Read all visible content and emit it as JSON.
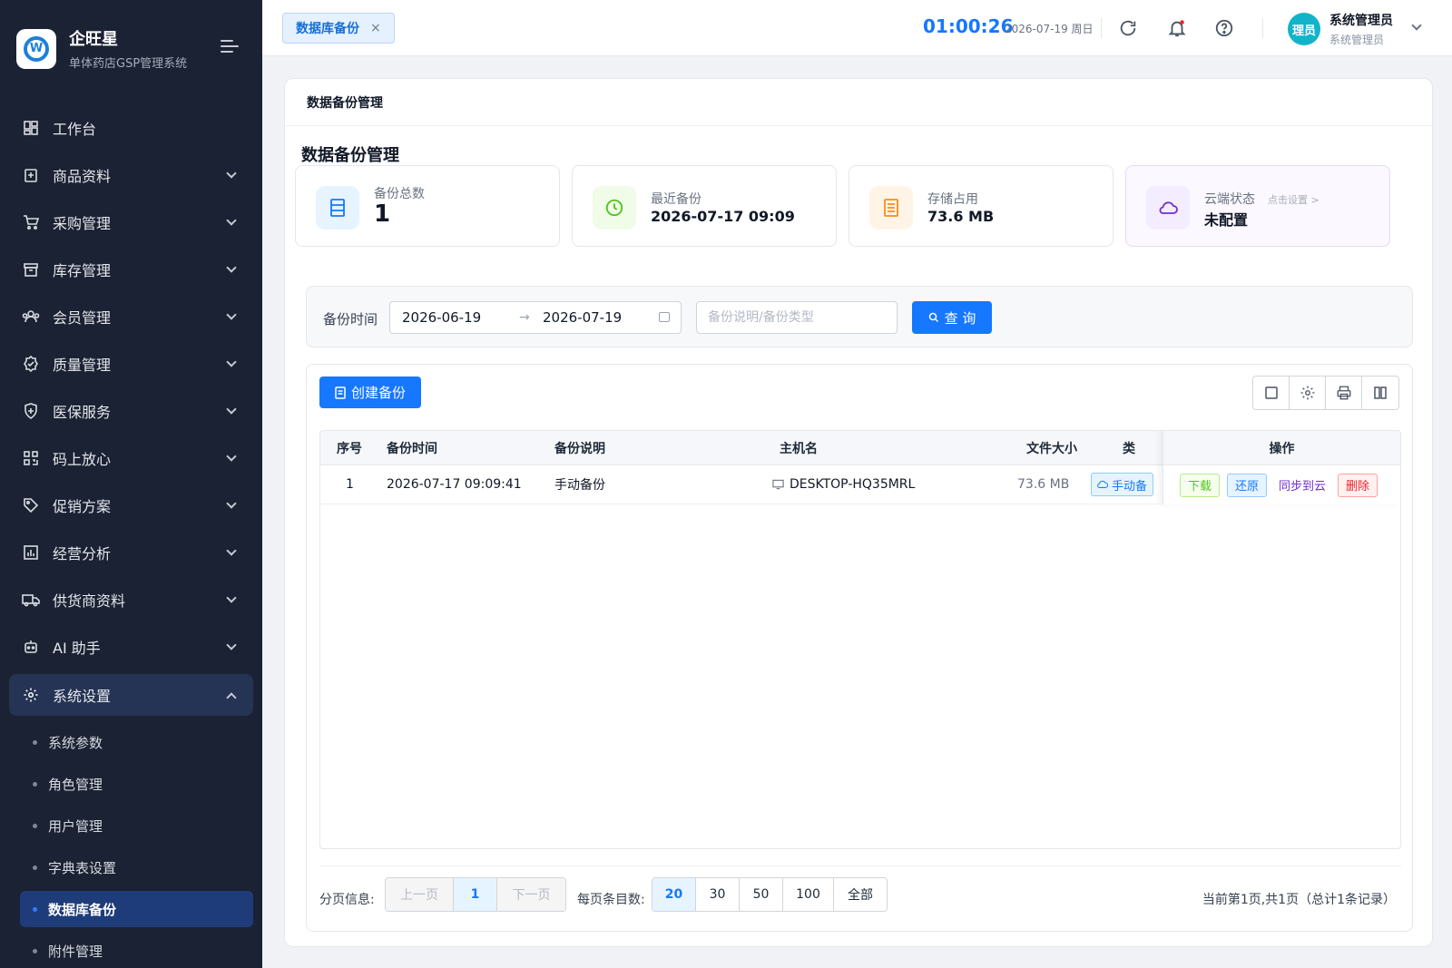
{
  "brand": {
    "title": "企旺星",
    "subtitle": "单体药店GSP管理系统"
  },
  "menu": [
    {
      "label": "工作台",
      "icon": "dashboard-icon",
      "expandable": false
    },
    {
      "label": "商品资料",
      "icon": "product-icon",
      "expandable": true
    },
    {
      "label": "采购管理",
      "icon": "cart-icon",
      "expandable": true
    },
    {
      "label": "库存管理",
      "icon": "inventory-icon",
      "expandable": true
    },
    {
      "label": "会员管理",
      "icon": "members-icon",
      "expandable": true
    },
    {
      "label": "质量管理",
      "icon": "quality-icon",
      "expandable": true
    },
    {
      "label": "医保服务",
      "icon": "shield-icon",
      "expandable": true
    },
    {
      "label": "码上放心",
      "icon": "qrcode-icon",
      "expandable": true
    },
    {
      "label": "促销方案",
      "icon": "tag-icon",
      "expandable": true
    },
    {
      "label": "经营分析",
      "icon": "analytics-icon",
      "expandable": true
    },
    {
      "label": "供货商资料",
      "icon": "truck-icon",
      "expandable": true
    },
    {
      "label": "AI 助手",
      "icon": "robot-icon",
      "expandable": true
    },
    {
      "label": "系统设置",
      "icon": "gear-icon",
      "expandable": true,
      "open": true
    }
  ],
  "submenu": [
    {
      "label": "系统参数"
    },
    {
      "label": "角色管理"
    },
    {
      "label": "用户管理"
    },
    {
      "label": "字典表设置"
    },
    {
      "label": "数据库备份",
      "active": true
    },
    {
      "label": "附件管理"
    }
  ],
  "header": {
    "tab_label": "数据库备份",
    "tab_close": "×",
    "clock": "01:00:26",
    "date": "2026-07-19 周日",
    "user_avatar": "理员",
    "user_name": "系统管理员",
    "user_role": "系统管理员"
  },
  "panel": {
    "breadcrumb": "数据备份管理",
    "title": "数据备份管理"
  },
  "stats": [
    {
      "label": "备份总数",
      "value": "1",
      "icon": "database-icon",
      "bg": "#e6f4ff",
      "fg": "#1677ff"
    },
    {
      "label": "最近备份",
      "value": "2026-07-17 09:09",
      "icon": "clock-icon",
      "bg": "#f0fbe8",
      "fg": "#52c41a"
    },
    {
      "label": "存储占用",
      "value": "73.6 MB",
      "icon": "storage-icon",
      "bg": "#fff4e6",
      "fg": "#fa8c16"
    },
    {
      "label": "云端状态",
      "value": "未配置",
      "hint": "点击设置 >",
      "icon": "cloud-icon",
      "bg": "#f4ecff",
      "fg": "#722ed1"
    }
  ],
  "filter": {
    "label": "备份时间",
    "start_date": "2026-06-19",
    "end_date": "2026-07-19",
    "arrow": "→",
    "search_placeholder": "备份说明/备份类型",
    "query_label": "查 询"
  },
  "toolbar": {
    "create_label": "创建备份"
  },
  "table": {
    "columns": [
      "序号",
      "备份时间",
      "备份说明",
      "主机名",
      "文件大小",
      "类",
      "操作"
    ],
    "rows": [
      {
        "index": "1",
        "time": "2026-07-17 09:09:41",
        "desc": "手动备份",
        "host": "DESKTOP-HQ35MRL",
        "size": "73.6 MB",
        "type": "手动备"
      }
    ],
    "actions": [
      "下载",
      "还原",
      "同步到云",
      "删除"
    ]
  },
  "pagination": {
    "info_label": "分页信息:",
    "prev": "上一页",
    "current": "1",
    "next": "下一页",
    "size_label": "每页条目数:",
    "sizes": [
      "20",
      "30",
      "50",
      "100",
      "全部"
    ],
    "summary": "当前第1页,共1页（总计1条记录）"
  }
}
